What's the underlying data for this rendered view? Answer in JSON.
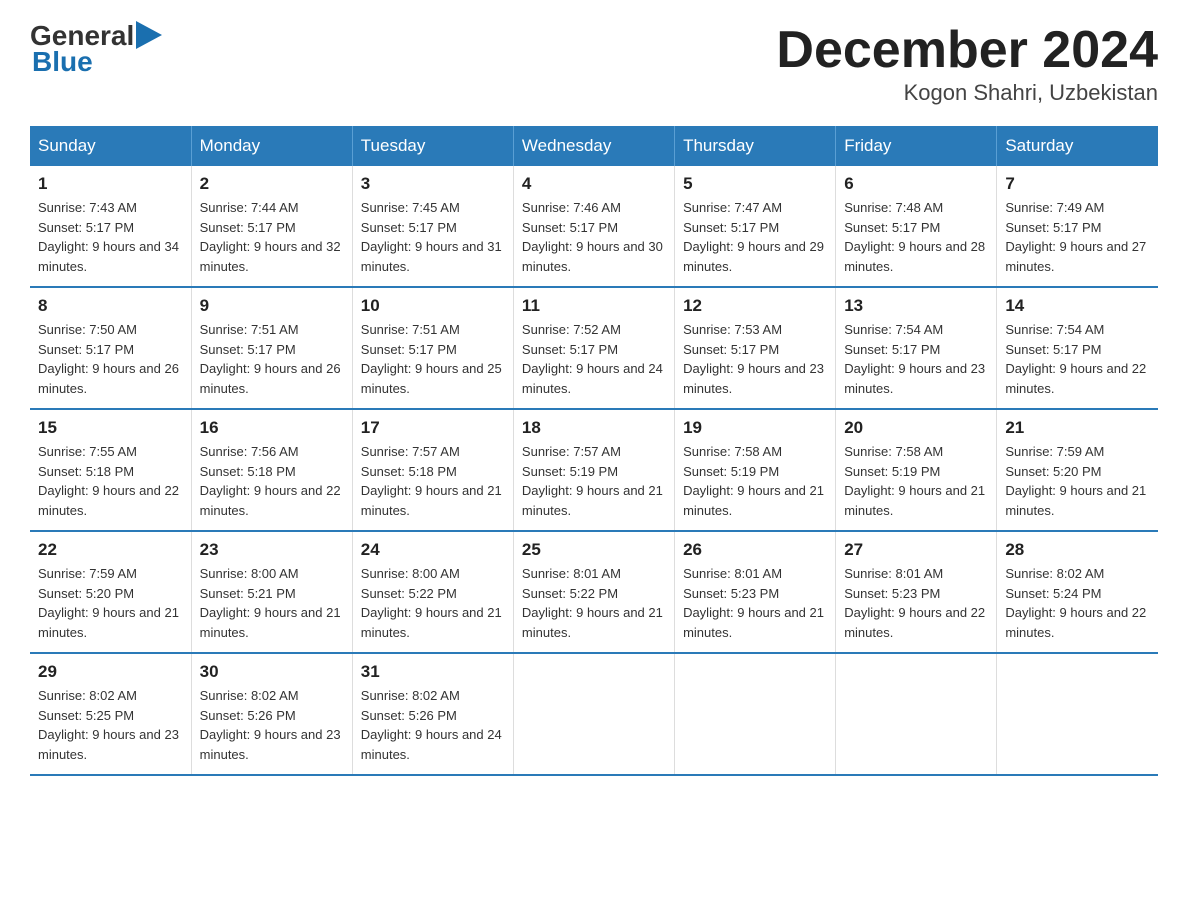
{
  "logo": {
    "general": "General",
    "blue": "Blue"
  },
  "title": "December 2024",
  "subtitle": "Kogon Shahri, Uzbekistan",
  "headers": [
    "Sunday",
    "Monday",
    "Tuesday",
    "Wednesday",
    "Thursday",
    "Friday",
    "Saturday"
  ],
  "weeks": [
    [
      {
        "day": "1",
        "sunrise": "7:43 AM",
        "sunset": "5:17 PM",
        "daylight": "9 hours and 34 minutes."
      },
      {
        "day": "2",
        "sunrise": "7:44 AM",
        "sunset": "5:17 PM",
        "daylight": "9 hours and 32 minutes."
      },
      {
        "day": "3",
        "sunrise": "7:45 AM",
        "sunset": "5:17 PM",
        "daylight": "9 hours and 31 minutes."
      },
      {
        "day": "4",
        "sunrise": "7:46 AM",
        "sunset": "5:17 PM",
        "daylight": "9 hours and 30 minutes."
      },
      {
        "day": "5",
        "sunrise": "7:47 AM",
        "sunset": "5:17 PM",
        "daylight": "9 hours and 29 minutes."
      },
      {
        "day": "6",
        "sunrise": "7:48 AM",
        "sunset": "5:17 PM",
        "daylight": "9 hours and 28 minutes."
      },
      {
        "day": "7",
        "sunrise": "7:49 AM",
        "sunset": "5:17 PM",
        "daylight": "9 hours and 27 minutes."
      }
    ],
    [
      {
        "day": "8",
        "sunrise": "7:50 AM",
        "sunset": "5:17 PM",
        "daylight": "9 hours and 26 minutes."
      },
      {
        "day": "9",
        "sunrise": "7:51 AM",
        "sunset": "5:17 PM",
        "daylight": "9 hours and 26 minutes."
      },
      {
        "day": "10",
        "sunrise": "7:51 AM",
        "sunset": "5:17 PM",
        "daylight": "9 hours and 25 minutes."
      },
      {
        "day": "11",
        "sunrise": "7:52 AM",
        "sunset": "5:17 PM",
        "daylight": "9 hours and 24 minutes."
      },
      {
        "day": "12",
        "sunrise": "7:53 AM",
        "sunset": "5:17 PM",
        "daylight": "9 hours and 23 minutes."
      },
      {
        "day": "13",
        "sunrise": "7:54 AM",
        "sunset": "5:17 PM",
        "daylight": "9 hours and 23 minutes."
      },
      {
        "day": "14",
        "sunrise": "7:54 AM",
        "sunset": "5:17 PM",
        "daylight": "9 hours and 22 minutes."
      }
    ],
    [
      {
        "day": "15",
        "sunrise": "7:55 AM",
        "sunset": "5:18 PM",
        "daylight": "9 hours and 22 minutes."
      },
      {
        "day": "16",
        "sunrise": "7:56 AM",
        "sunset": "5:18 PM",
        "daylight": "9 hours and 22 minutes."
      },
      {
        "day": "17",
        "sunrise": "7:57 AM",
        "sunset": "5:18 PM",
        "daylight": "9 hours and 21 minutes."
      },
      {
        "day": "18",
        "sunrise": "7:57 AM",
        "sunset": "5:19 PM",
        "daylight": "9 hours and 21 minutes."
      },
      {
        "day": "19",
        "sunrise": "7:58 AM",
        "sunset": "5:19 PM",
        "daylight": "9 hours and 21 minutes."
      },
      {
        "day": "20",
        "sunrise": "7:58 AM",
        "sunset": "5:19 PM",
        "daylight": "9 hours and 21 minutes."
      },
      {
        "day": "21",
        "sunrise": "7:59 AM",
        "sunset": "5:20 PM",
        "daylight": "9 hours and 21 minutes."
      }
    ],
    [
      {
        "day": "22",
        "sunrise": "7:59 AM",
        "sunset": "5:20 PM",
        "daylight": "9 hours and 21 minutes."
      },
      {
        "day": "23",
        "sunrise": "8:00 AM",
        "sunset": "5:21 PM",
        "daylight": "9 hours and 21 minutes."
      },
      {
        "day": "24",
        "sunrise": "8:00 AM",
        "sunset": "5:22 PM",
        "daylight": "9 hours and 21 minutes."
      },
      {
        "day": "25",
        "sunrise": "8:01 AM",
        "sunset": "5:22 PM",
        "daylight": "9 hours and 21 minutes."
      },
      {
        "day": "26",
        "sunrise": "8:01 AM",
        "sunset": "5:23 PM",
        "daylight": "9 hours and 21 minutes."
      },
      {
        "day": "27",
        "sunrise": "8:01 AM",
        "sunset": "5:23 PM",
        "daylight": "9 hours and 22 minutes."
      },
      {
        "day": "28",
        "sunrise": "8:02 AM",
        "sunset": "5:24 PM",
        "daylight": "9 hours and 22 minutes."
      }
    ],
    [
      {
        "day": "29",
        "sunrise": "8:02 AM",
        "sunset": "5:25 PM",
        "daylight": "9 hours and 23 minutes."
      },
      {
        "day": "30",
        "sunrise": "8:02 AM",
        "sunset": "5:26 PM",
        "daylight": "9 hours and 23 minutes."
      },
      {
        "day": "31",
        "sunrise": "8:02 AM",
        "sunset": "5:26 PM",
        "daylight": "9 hours and 24 minutes."
      },
      null,
      null,
      null,
      null
    ]
  ]
}
